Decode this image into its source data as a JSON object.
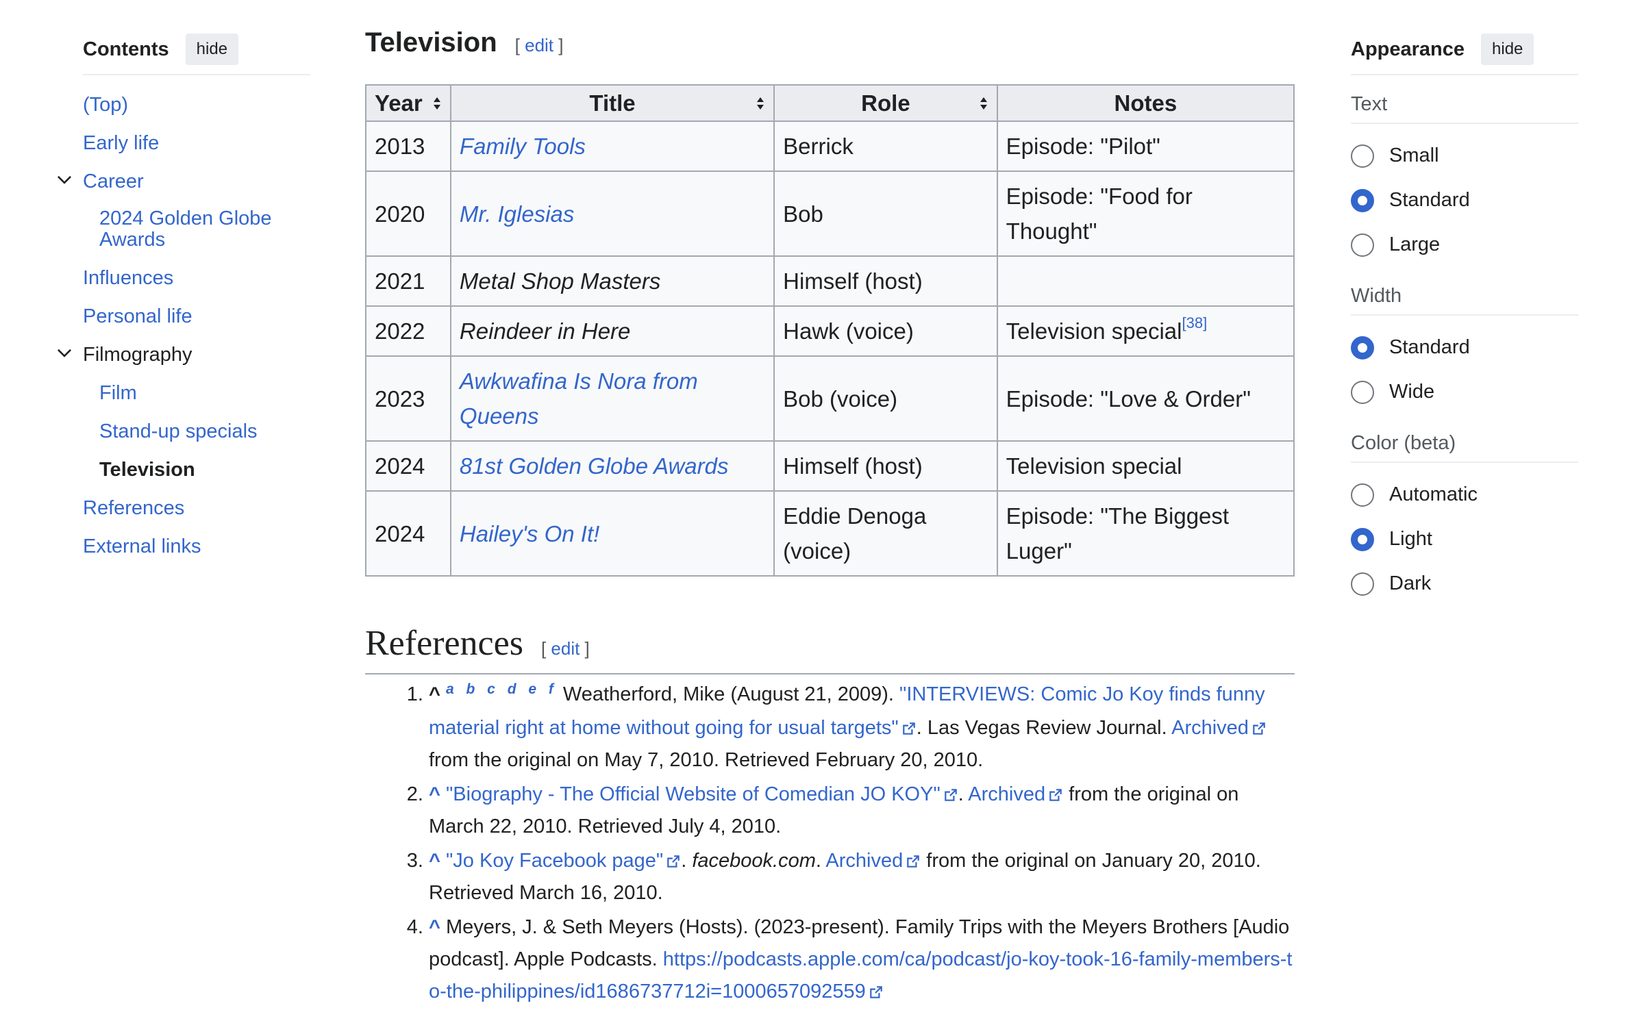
{
  "toc": {
    "title": "Contents",
    "hide_label": "hide",
    "items": [
      {
        "label": "(Top)",
        "level": 1
      },
      {
        "label": "Early life",
        "level": 1
      },
      {
        "label": "Career",
        "level": 1,
        "expanded": true
      },
      {
        "label": "2024 Golden Globe Awards",
        "level": 2
      },
      {
        "label": "Influences",
        "level": 1
      },
      {
        "label": "Personal life",
        "level": 1
      },
      {
        "label": "Filmography",
        "level": 1,
        "expanded": true
      },
      {
        "label": "Film",
        "level": 2
      },
      {
        "label": "Stand-up specials",
        "level": 2
      },
      {
        "label": "Television",
        "level": 2,
        "active": true
      },
      {
        "label": "References",
        "level": 1
      },
      {
        "label": "External links",
        "level": 1
      }
    ]
  },
  "television": {
    "heading": "Television",
    "edit_label": "edit",
    "headers": [
      "Year",
      "Title",
      "Role",
      "Notes"
    ],
    "rows": [
      {
        "year": "2013",
        "title": "Family Tools",
        "title_link": true,
        "role": "Berrick",
        "notes": "Episode: \"Pilot\"",
        "note_ref": ""
      },
      {
        "year": "2020",
        "title": "Mr. Iglesias",
        "title_link": true,
        "role": "Bob",
        "notes": "Episode: \"Food for Thought\"",
        "note_ref": ""
      },
      {
        "year": "2021",
        "title": "Metal Shop Masters",
        "title_link": false,
        "role": "Himself (host)",
        "notes": "",
        "note_ref": ""
      },
      {
        "year": "2022",
        "title": "Reindeer in Here",
        "title_link": false,
        "role": "Hawk (voice)",
        "notes": "Television special",
        "note_ref": "[38]"
      },
      {
        "year": "2023",
        "title": "Awkwafina Is Nora from Queens",
        "title_link": true,
        "role": "Bob (voice)",
        "notes": "Episode: \"Love & Order\"",
        "note_ref": ""
      },
      {
        "year": "2024",
        "title": "81st Golden Globe Awards",
        "title_link": true,
        "role": "Himself (host)",
        "notes": "Television special",
        "note_ref": ""
      },
      {
        "year": "2024",
        "title": "Hailey's On It!",
        "title_link": true,
        "role": "Eddie Denoga (voice)",
        "notes": "Episode: \"The Biggest Luger\"",
        "note_ref": ""
      }
    ]
  },
  "references": {
    "heading": "References",
    "edit_label": "edit",
    "items": {
      "r1": {
        "caret": "^",
        "letters": "a b c d e f",
        "authors": " Weatherford, Mike (August 21, 2009). ",
        "title": "\"INTERVIEWS: Comic Jo Koy finds funny material right at home without going for usual targets\"",
        "after_title": ". Las Vegas Review Journal. ",
        "archived": "Archived",
        "rest": " from the original on May 7, 2010. Retrieved February 20, 2010."
      },
      "r2": {
        "caret": "^",
        "title": "\"Biography - The Official Website of Comedian JO KOY\"",
        "after_title": ". ",
        "archived": "Archived",
        "rest": " from the original on March 22, 2010. Retrieved July 4, 2010."
      },
      "r3": {
        "caret": "^",
        "title": "\"Jo Koy Facebook page\"",
        "after_title": ". ",
        "publisher": "facebook.com",
        "after_publisher": ". ",
        "archived": "Archived",
        "rest": " from the original on January 20, 2010. Retrieved March 16, 2010."
      },
      "r4": {
        "caret": "^",
        "text": " Meyers, J. & Seth Meyers (Hosts). (2023-present). Family Trips with the Meyers Brothers [Audio podcast]. Apple Podcasts. ",
        "url": "https://podcasts.apple.com/ca/podcast/jo-koy-took-16-family-members-to-the-philippines/id1686737712i=1000657092559"
      }
    }
  },
  "appearance": {
    "title": "Appearance",
    "hide_label": "hide",
    "groups": {
      "text": {
        "title": "Text",
        "options": [
          "Small",
          "Standard",
          "Large"
        ],
        "selected": "Standard"
      },
      "width": {
        "title": "Width",
        "options": [
          "Standard",
          "Wide"
        ],
        "selected": "Standard"
      },
      "color": {
        "title": "Color (beta)",
        "options": [
          "Automatic",
          "Light",
          "Dark"
        ],
        "selected": "Light"
      }
    }
  },
  "colors": {
    "link": "#3366cc",
    "text": "#202122",
    "table_header": "#eaecf0",
    "table_border": "#a2a9b1"
  }
}
